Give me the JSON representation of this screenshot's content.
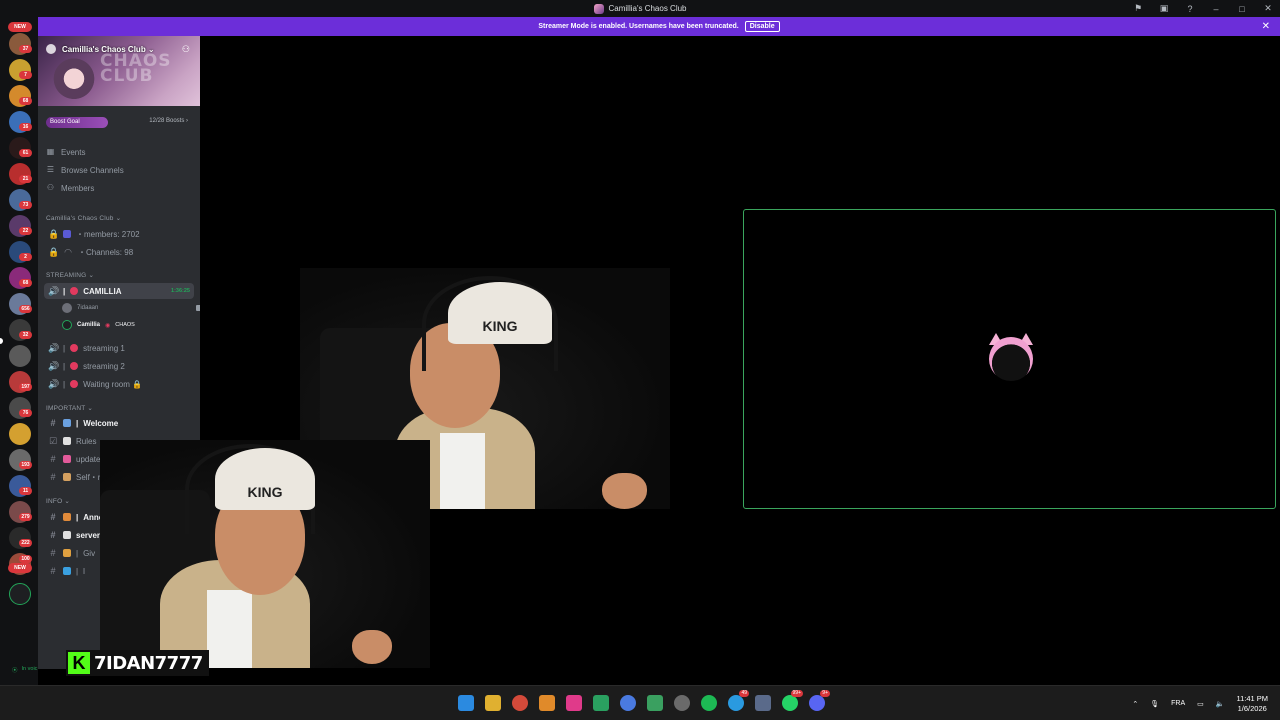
{
  "window": {
    "title": "Camillia's Chaos Club"
  },
  "banner": {
    "text": "Streamer Mode is enabled. Usernames have been truncated.",
    "disable_label": "Disable"
  },
  "rail": {
    "new_top": "NEW",
    "new_bottom": "NEW",
    "badges": [
      "37",
      "7",
      "68",
      "16",
      "61",
      "21",
      "73",
      "22",
      "2",
      "68",
      "656",
      "32",
      "197",
      "76",
      "193",
      "11",
      "279",
      "222",
      "100"
    ]
  },
  "server": {
    "name": "Camillia's Chaos Club",
    "banner_art": "CHAOS CLUB",
    "boost_label": "Boost Goal",
    "boost_count": "12/28 Boosts",
    "boost_progress": 0.43
  },
  "nav": [
    {
      "label": "Events",
      "icon": "calendar-icon"
    },
    {
      "label": "Browse Channels",
      "icon": "list-icon"
    },
    {
      "label": "Members",
      "icon": "members-icon"
    }
  ],
  "categories": {
    "top": "Camillia's Chaos Club",
    "streaming": "STREAMING",
    "important": "IMPORTANT",
    "info": "INFO"
  },
  "stats": [
    {
      "label": "・members: 2702"
    },
    {
      "label": "・Channels: 98"
    }
  ],
  "streaming": {
    "live_channel": "CAMILLIA",
    "live_time": "1:36:25",
    "users": [
      {
        "name": "7idaaan"
      },
      {
        "name": "Camillia",
        "tag": "CHAOS"
      }
    ],
    "channels": [
      "streaming 1",
      "streaming 2",
      "Waiting room 🔒"
    ]
  },
  "important": [
    "Welcome",
    "Rules",
    "updates",
    "Self・roles"
  ],
  "info": [
    "Announce",
    "server-",
    "Giv",
    "l"
  ],
  "overlay": {
    "username": "7IDAN7777",
    "logo": "K",
    "beanie_text": "KING"
  },
  "voice_status": "In voic",
  "taskbar": {
    "lang": "FRA",
    "time": "11:41 PM",
    "date": "1/6/2026",
    "badges": {
      "whatsapp": "99+",
      "telegram": "49",
      "discord": "9+"
    }
  }
}
